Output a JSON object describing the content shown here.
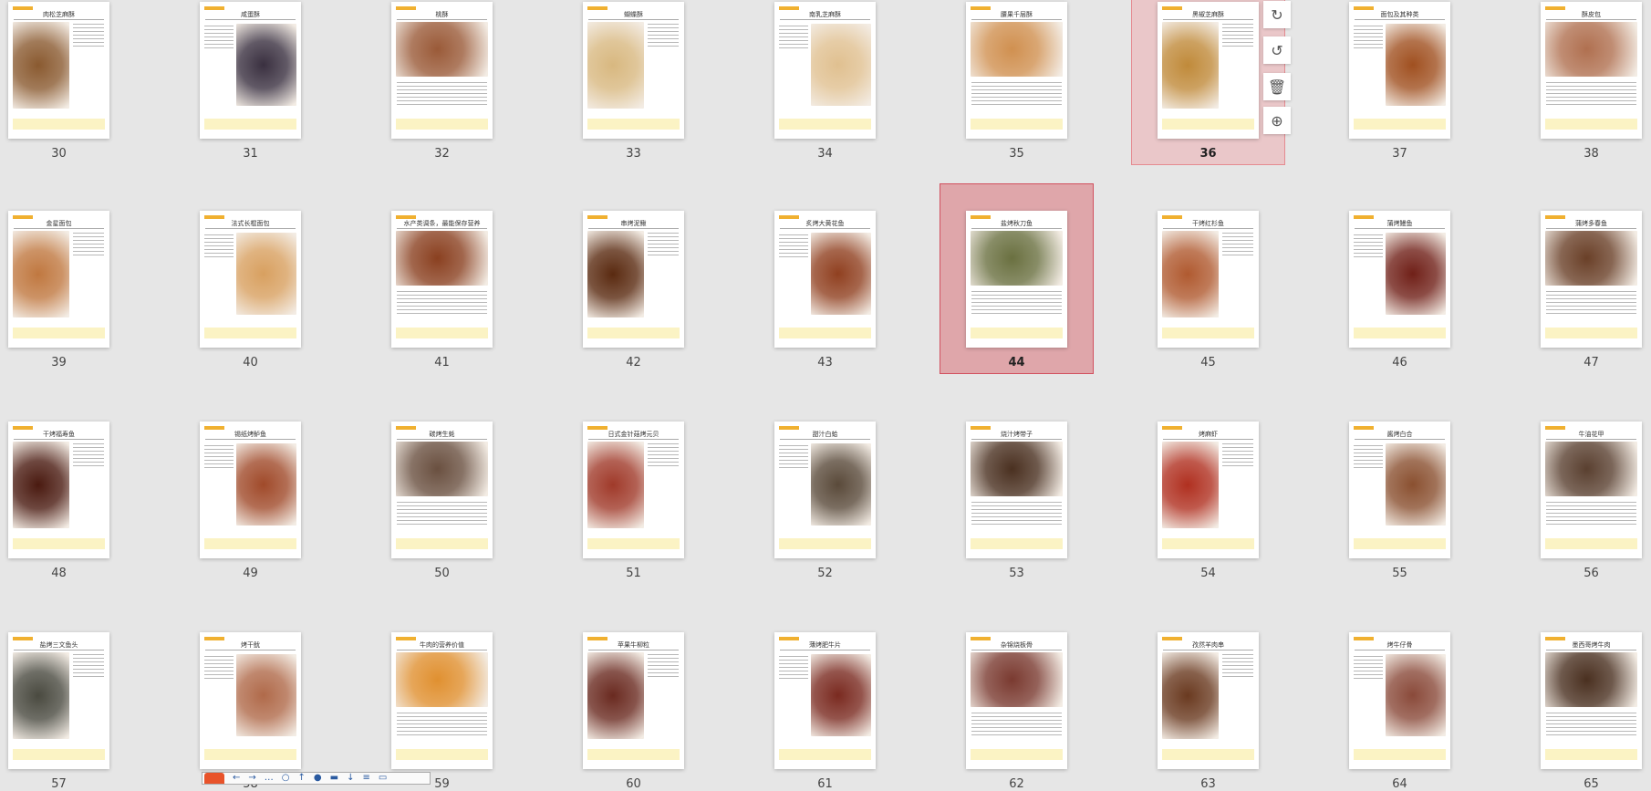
{
  "pages": [
    {
      "num": "30",
      "title": "肉松芝麻酥",
      "tone": "#8a5a30"
    },
    {
      "num": "31",
      "title": "咸蛋酥",
      "tone": "#3a3040"
    },
    {
      "num": "32",
      "title": "桃酥",
      "tone": "#9a5a38"
    },
    {
      "num": "33",
      "title": "蝴蝶酥",
      "tone": "#d8b880"
    },
    {
      "num": "34",
      "title": "南乳芝麻酥",
      "tone": "#e0c090"
    },
    {
      "num": "35",
      "title": "腰果千层酥",
      "tone": "#d09050"
    },
    {
      "num": "36",
      "title": "黑椒芝麻酥",
      "tone": "#c08a3a"
    },
    {
      "num": "37",
      "title": "面包及其种类",
      "tone": "#a05020"
    },
    {
      "num": "38",
      "title": "酥皮包",
      "tone": "#b07050"
    },
    {
      "num": "39",
      "title": "金星面包",
      "tone": "#c07840"
    },
    {
      "num": "40",
      "title": "法式长棍面包",
      "tone": "#d8a060"
    },
    {
      "num": "41",
      "title": "水产类调条，最能保存营养",
      "tone": "#8a4020"
    },
    {
      "num": "42",
      "title": "串烤泥鳅",
      "tone": "#5a2a10"
    },
    {
      "num": "43",
      "title": "炙烤大黄花鱼",
      "tone": "#904020"
    },
    {
      "num": "44",
      "title": "盐烤秋刀鱼",
      "tone": "#6a7040"
    },
    {
      "num": "45",
      "title": "干烤红杉鱼",
      "tone": "#b05a30"
    },
    {
      "num": "46",
      "title": "蒲烤鳗鱼",
      "tone": "#702018"
    },
    {
      "num": "47",
      "title": "蒲烤多春鱼",
      "tone": "#6a4028"
    },
    {
      "num": "48",
      "title": "干烤福寿鱼",
      "tone": "#4a1a10"
    },
    {
      "num": "49",
      "title": "锡纸烤鲈鱼",
      "tone": "#a04a2a"
    },
    {
      "num": "50",
      "title": "碳烤生蚝",
      "tone": "#6a5040"
    },
    {
      "num": "51",
      "title": "日式金针菇烤元贝",
      "tone": "#a03a2a"
    },
    {
      "num": "52",
      "title": "甜汁白蛤",
      "tone": "#5a4a3a"
    },
    {
      "num": "53",
      "title": "烧汁烤带子",
      "tone": "#4a3020"
    },
    {
      "num": "54",
      "title": "烤麻虾",
      "tone": "#b03020"
    },
    {
      "num": "55",
      "title": "酱烤白合",
      "tone": "#8a5030"
    },
    {
      "num": "56",
      "title": "牛油花甲",
      "tone": "#5a4030"
    },
    {
      "num": "57",
      "title": "盐烤三文鱼头",
      "tone": "#4a4a40"
    },
    {
      "num": "58",
      "title": "烤干鱿",
      "tone": "#b06a4a"
    },
    {
      "num": "59",
      "title": "牛肉的营养价值",
      "tone": "#e09030"
    },
    {
      "num": "60",
      "title": "苹果牛柳粒",
      "tone": "#6a2a20"
    },
    {
      "num": "61",
      "title": "薄烤肥牛片",
      "tone": "#7a2a20"
    },
    {
      "num": "62",
      "title": "杂锦烧板骨",
      "tone": "#7a3a30"
    },
    {
      "num": "63",
      "title": "孜然羊肉串",
      "tone": "#6a3a20"
    },
    {
      "num": "64",
      "title": "烤牛仔骨",
      "tone": "#8a4a3a"
    },
    {
      "num": "65",
      "title": "墨西哥烤牛肉",
      "tone": "#4a3020"
    }
  ],
  "hovered_page": "36",
  "selected_page": "44",
  "page_tools": [
    {
      "icon": "rotate-clockwise-icon",
      "glyph": "↻"
    },
    {
      "icon": "rotate-counterclockwise-icon",
      "glyph": "↺"
    },
    {
      "icon": "trash-icon",
      "glyph": "🗑"
    },
    {
      "icon": "zoom-in-icon",
      "glyph": "⊕"
    }
  ],
  "bottom_toolbar": {
    "glyphs": [
      "←",
      "→",
      "…",
      "○",
      "↑",
      "●",
      "▬",
      "↓",
      "≡",
      "▭"
    ]
  }
}
